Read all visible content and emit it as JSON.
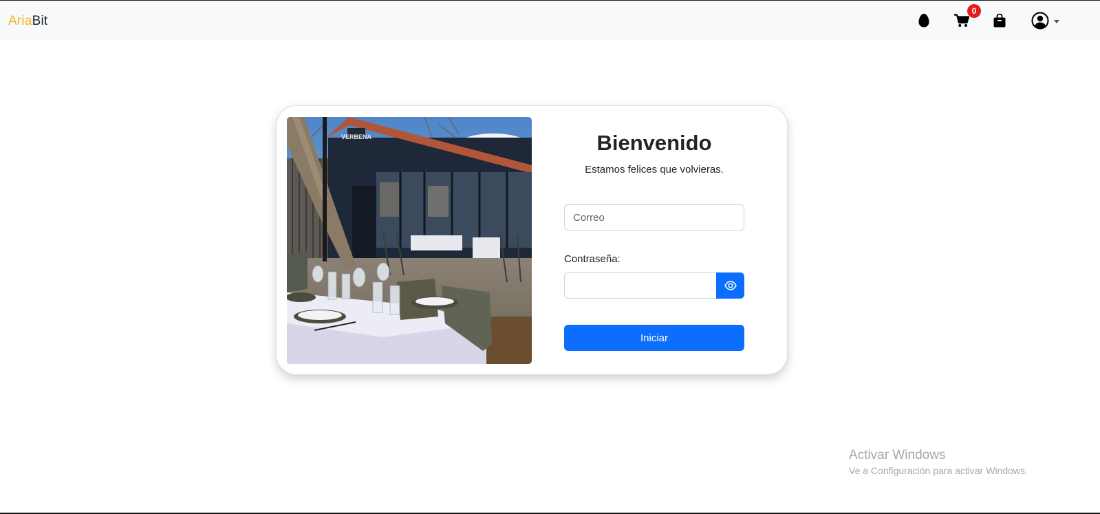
{
  "navbar": {
    "brand_part1": "Aria",
    "brand_part2": "Bit",
    "cart_badge": "0",
    "icons": [
      "egg-icon",
      "cart-icon",
      "bag-icon",
      "user-circle-icon"
    ]
  },
  "login": {
    "title": "Bienvenido",
    "subtitle": "Estamos felices que volvieras.",
    "email_placeholder": "Correo",
    "email_value": "",
    "password_label": "Contraseña:",
    "password_value": "",
    "submit_label": "Iniciar",
    "photo_sign": "VERBENA"
  },
  "watermark": {
    "title": "Activar Windows",
    "subtitle": "Ve a Configuración para activar Windows."
  },
  "colors": {
    "brand_accent": "#f5b324",
    "primary": "#0d6efd",
    "badge": "#e11d1d",
    "navbar_bg": "#f8f9fa"
  }
}
